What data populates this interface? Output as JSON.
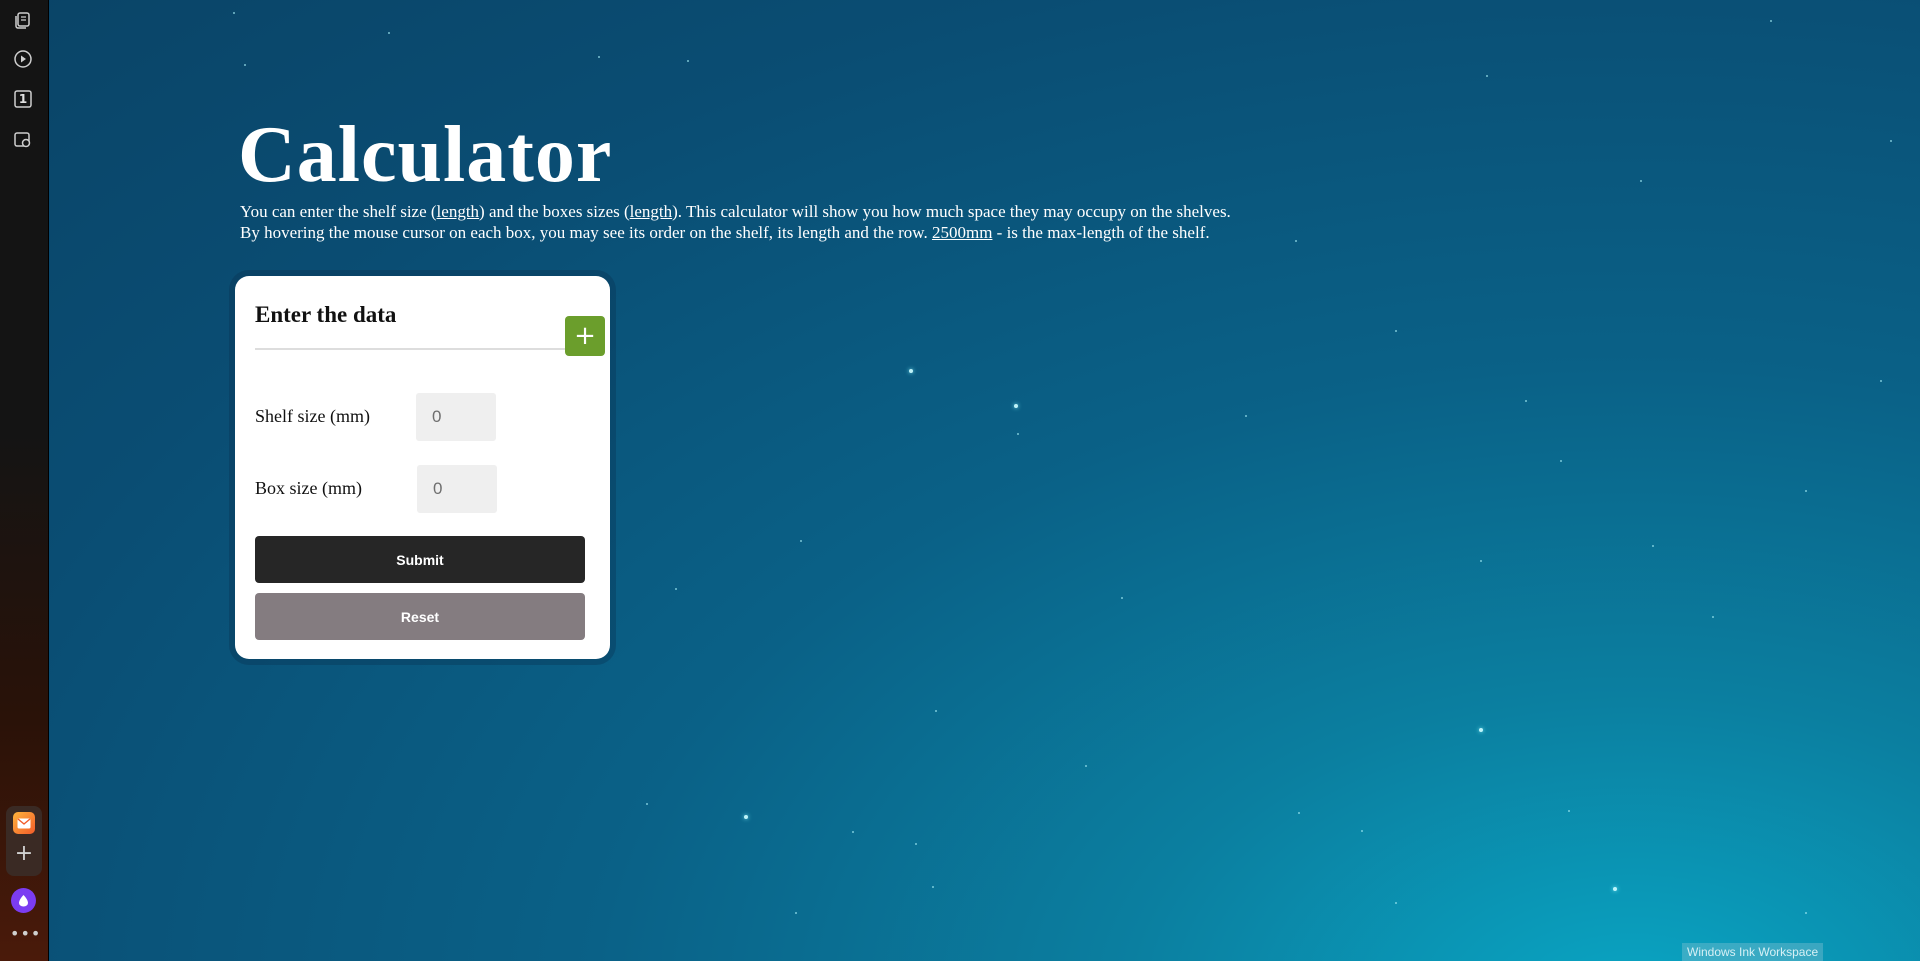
{
  "page": {
    "title": "Calculator",
    "description": {
      "line1_part1": "You can enter the shelf size (",
      "line1_link1": "length",
      "line1_part2": ") and the boxes sizes (",
      "line1_link2": "length",
      "line1_part3": "). This calculator will show you how much space they may occupy on the shelves.",
      "line2_part1": "By hovering the mouse cursor on each box, you may see its order on the shelf, its length and the row. ",
      "line2_highlight": "2500mm",
      "line2_part2": " - is the max-length of the shelf."
    }
  },
  "form": {
    "title": "Enter the data",
    "add_label": "+",
    "shelf_label": "Shelf size (mm)",
    "shelf_placeholder": "0",
    "box_label": "Box size (mm)",
    "box_placeholder": "0",
    "submit_label": "Submit",
    "reset_label": "Reset"
  },
  "sidebar": {
    "items": [
      {
        "icon": "collections-icon"
      },
      {
        "icon": "video-play-icon"
      },
      {
        "icon": "tab-count-icon",
        "label": "1"
      },
      {
        "icon": "screenshot-camera-icon"
      }
    ],
    "bottom": [
      "mail-app-icon",
      "add-app-icon",
      "alice-assistant-icon",
      "more-icon"
    ]
  },
  "system": {
    "ink_workspace_label": "Windows Ink Workspace"
  },
  "colors": {
    "add_button": "#6b9e2c",
    "submit_button": "#262626",
    "reset_button": "#847c80",
    "background": "#0a5a80"
  }
}
